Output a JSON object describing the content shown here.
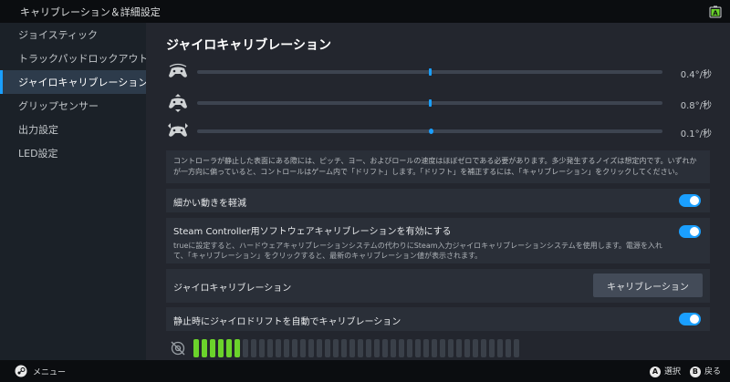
{
  "topbar": {
    "title": "キャリブレーション＆詳細設定"
  },
  "sidebar": {
    "items": [
      {
        "label": "ジョイスティック"
      },
      {
        "label": "トラックパッドロックアウト"
      },
      {
        "label": "ジャイロキャリブレーション"
      },
      {
        "label": "グリップセンサー"
      },
      {
        "label": "出力設定"
      },
      {
        "label": "LED設定"
      }
    ]
  },
  "main": {
    "title": "ジャイロキャリブレーション",
    "sliders": [
      {
        "icon": "controller-yaw-icon",
        "value": "0.4°/秒",
        "level": 0.5
      },
      {
        "icon": "controller-pitch-icon",
        "value": "0.8°/秒",
        "level": 0.5
      },
      {
        "icon": "controller-roll-icon",
        "value": "0.1°/秒",
        "level": 0.5
      }
    ],
    "description": "コントローラが静止した表面にある際には、ピッチ、ヨー、およびロールの速度はほぼゼロである必要があります。多少発生するノイズは想定内です。いずれかが一方向に偏っていると、コントロールはゲーム内で「ドリフト」します。「ドリフト」を補正するには、「キャリブレーション」をクリックしてください。",
    "reduce_fine_motion": {
      "label": "細かい動きを軽減",
      "enabled": true
    },
    "software_calibration": {
      "label": "Steam Controller用ソフトウェアキャリブレーションを有効にする",
      "desc": "trueに設定すると、ハードウェアキャリブレーションシステムの代わりにSteam入力ジャイロキャリブレーションシステムを使用します。電源を入れて、「キャリブレーション」をクリックすると、最新のキャリブレーション値が表示されます。",
      "enabled": true
    },
    "gyro_calibration": {
      "label": "ジャイロキャリブレーション",
      "button": "キャリブレーション"
    },
    "auto_drift": {
      "label": "静止時にジャイロドリフトを自動でキャリブレーション",
      "enabled": true
    },
    "meter": {
      "total": 40,
      "filled": 6
    }
  },
  "bottombar": {
    "menu": "メニュー",
    "select_key": "A",
    "select": "選択",
    "back_key": "B",
    "back": "戻る"
  },
  "colors": {
    "accent": "#1a9fff",
    "meter_on": "#6bd32b"
  }
}
